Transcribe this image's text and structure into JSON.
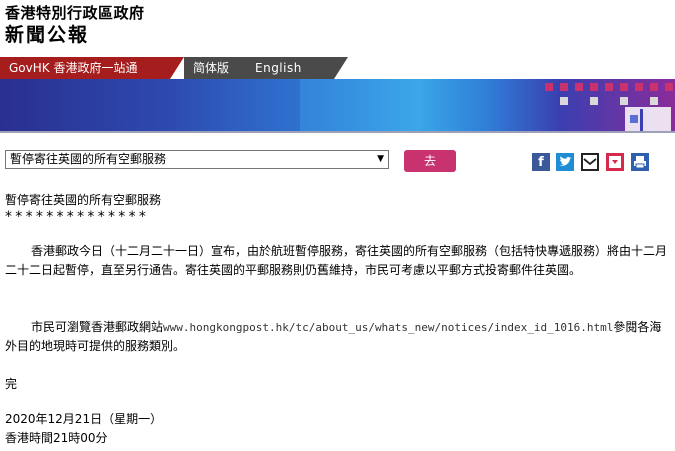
{
  "header": {
    "gov_name": "香港特別行政區政府",
    "site_name": "新聞公報"
  },
  "nav": {
    "govhk": "GovHK 香港政府一站通",
    "simplified": "简体版",
    "english": "English"
  },
  "toolbar": {
    "select_value": "暫停寄往英國的所有空郵服務",
    "go_label": "去",
    "share_icons": [
      "facebook-icon",
      "twitter-icon",
      "email-icon",
      "bookmark-icon",
      "print-icon"
    ]
  },
  "article": {
    "title": "暫停寄往英國的所有空郵服務",
    "stars": "**************",
    "para1": "香港郵政今日（十二月二十一日）宣布，由於航班暫停服務，寄往英國的所有空郵服務（包括特快專遞服務）將由十二月二十二日起暫停，直至另行通告。寄往英國的平郵服務則仍舊維持，市民可考慮以平郵方式投寄郵件往英國。",
    "para2_before": "市民可瀏覽香港郵政網站",
    "para2_link": "www.hongkongpost.hk/tc/about_us/whats_new/notices/index_id_1016.html",
    "para2_after": "參閱各海外目的地現時可提供的服務類別。",
    "end": "完",
    "date": "2020年12月21日（星期一）",
    "time": "香港時間21時00分"
  },
  "colors": {
    "govhk_red": "#a51d1d",
    "go_button": "#c8326e",
    "nav_grey": "#4a4a4a"
  }
}
